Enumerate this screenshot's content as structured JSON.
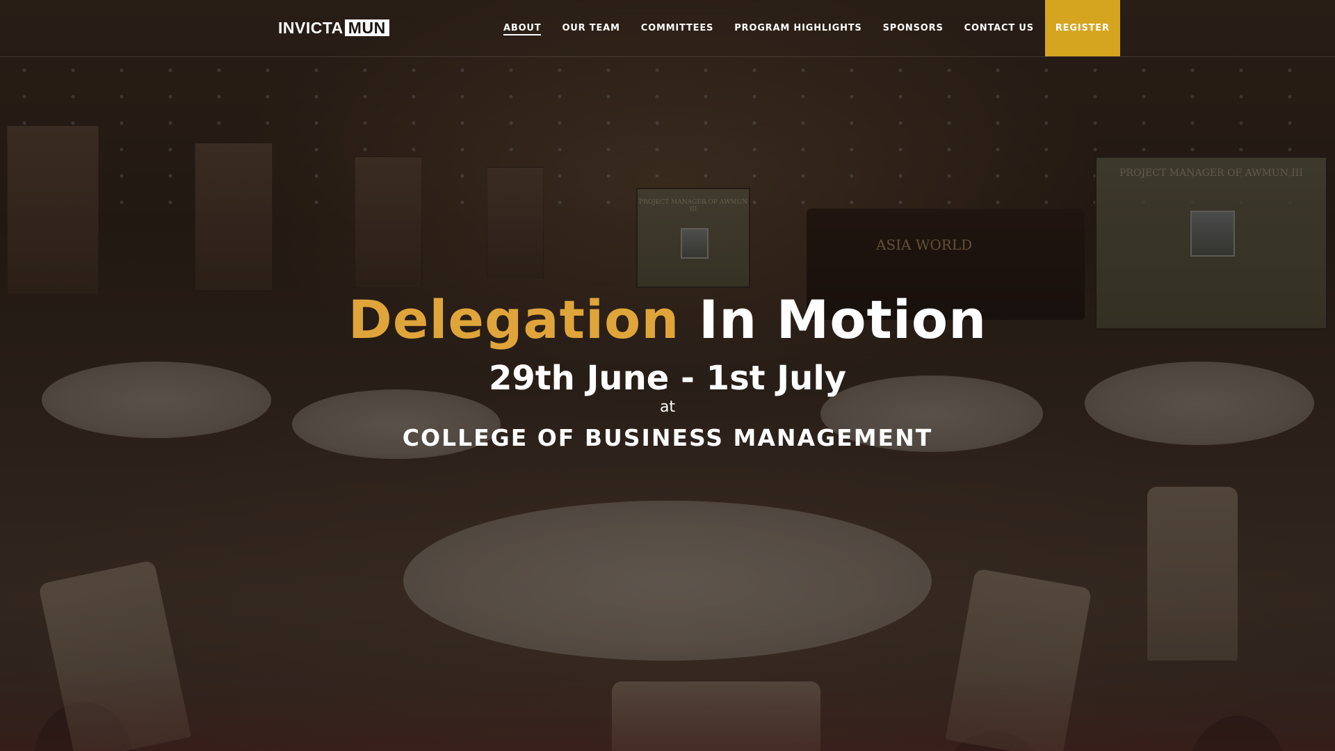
{
  "brand": {
    "logo_part1": "INVICTA",
    "logo_part2": "MUN",
    "accent_color": "#e0a53a",
    "register_color": "#d6a520"
  },
  "nav": {
    "items": [
      {
        "label": "ABOUT",
        "active": true
      },
      {
        "label": "OUR TEAM"
      },
      {
        "label": "COMMITTEES"
      },
      {
        "label": "PROGRAM HIGHLIGHTS"
      },
      {
        "label": "SPONSORS"
      },
      {
        "label": "CONTACT US"
      }
    ],
    "register_label": "REGISTER"
  },
  "hero": {
    "headline_accent": "Delegation",
    "headline_rest": "In Motion",
    "dates": "29th June - 1st July",
    "at": "at",
    "venue": "COLLEGE OF BUSINESS MANAGEMENT"
  },
  "background": {
    "screen_left_title": "PROJECT MANAGER OF AWMUN III",
    "screen_right_title": "PROJECT MANAGER OF AWMUN III",
    "stage_banner": "ASIA WORLD"
  }
}
